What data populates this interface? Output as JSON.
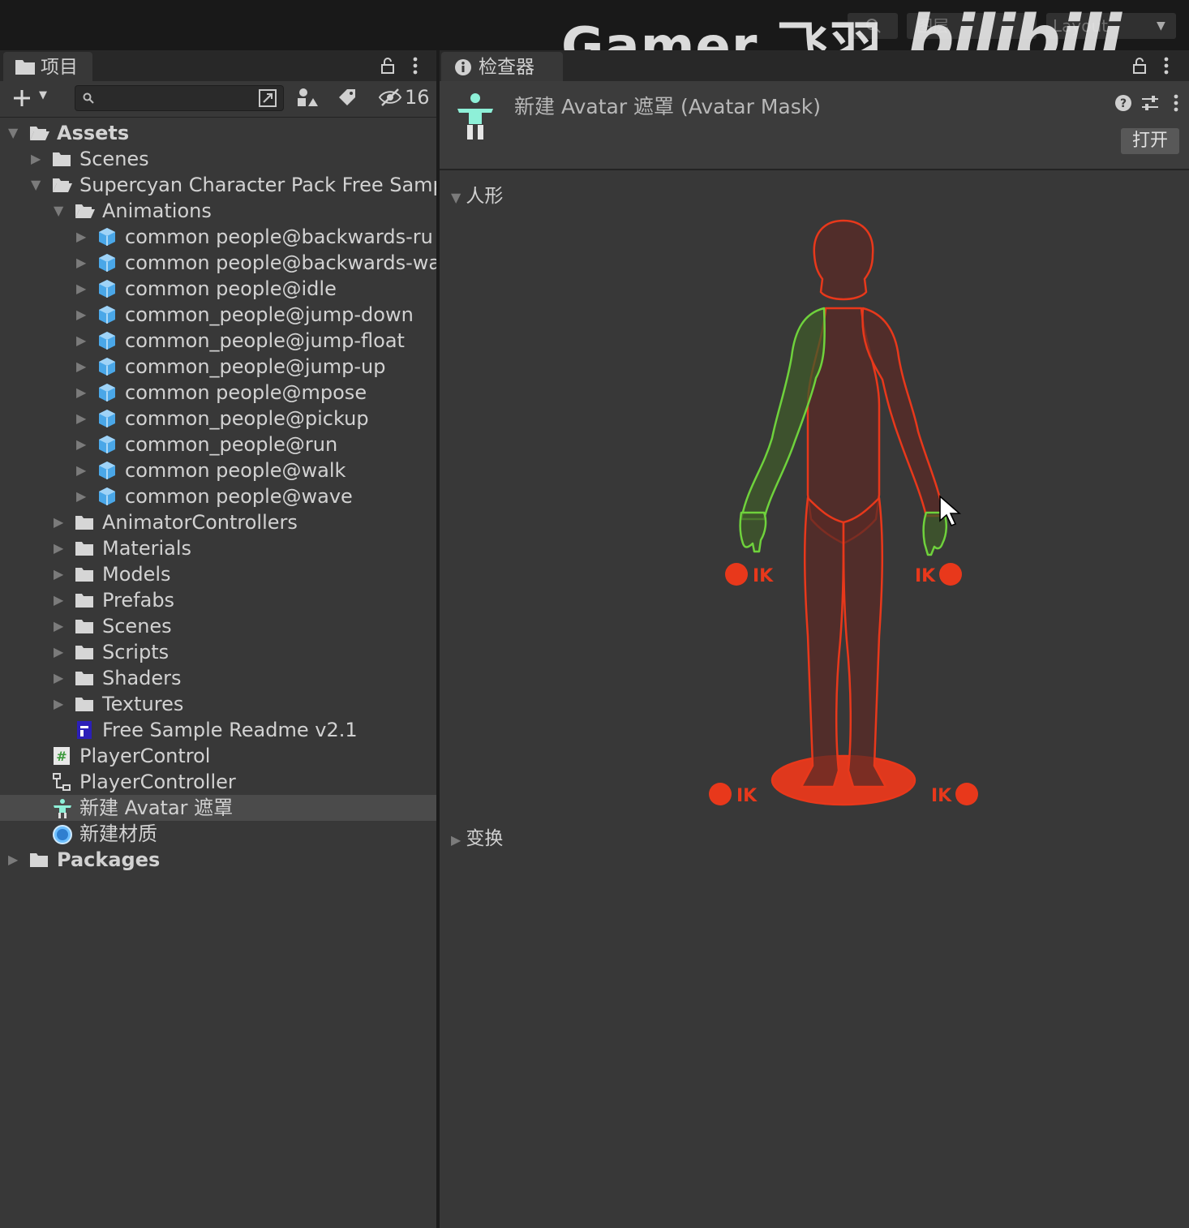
{
  "watermark": {
    "text": "Gamer 飞羽",
    "logo": "bilibili"
  },
  "topbar": {
    "layers_label": "图层",
    "layout_label": "Layout"
  },
  "project": {
    "tab_label": "项目",
    "hidden_count": "16",
    "tree": [
      {
        "label": "Assets",
        "depth": 0,
        "expanded": true,
        "icon": "folder-open-icon",
        "bold": true
      },
      {
        "label": "Scenes",
        "depth": 1,
        "expanded": false,
        "icon": "folder-icon"
      },
      {
        "label": "Supercyan Character Pack Free Sampl",
        "depth": 1,
        "expanded": true,
        "icon": "folder-open-icon"
      },
      {
        "label": "Animations",
        "depth": 2,
        "expanded": true,
        "icon": "folder-open-icon"
      },
      {
        "label": "common people@backwards-ru",
        "depth": 3,
        "expanded": false,
        "icon": "model-icon"
      },
      {
        "label": "common people@backwards-wa",
        "depth": 3,
        "expanded": false,
        "icon": "model-icon"
      },
      {
        "label": "common people@idle",
        "depth": 3,
        "expanded": false,
        "icon": "model-icon"
      },
      {
        "label": "common_people@jump-down",
        "depth": 3,
        "expanded": false,
        "icon": "model-icon"
      },
      {
        "label": "common_people@jump-float",
        "depth": 3,
        "expanded": false,
        "icon": "model-icon"
      },
      {
        "label": "common_people@jump-up",
        "depth": 3,
        "expanded": false,
        "icon": "model-icon"
      },
      {
        "label": "common people@mpose",
        "depth": 3,
        "expanded": false,
        "icon": "model-icon"
      },
      {
        "label": "common_people@pickup",
        "depth": 3,
        "expanded": false,
        "icon": "model-icon"
      },
      {
        "label": "common_people@run",
        "depth": 3,
        "expanded": false,
        "icon": "model-icon"
      },
      {
        "label": "common people@walk",
        "depth": 3,
        "expanded": false,
        "icon": "model-icon"
      },
      {
        "label": "common people@wave",
        "depth": 3,
        "expanded": false,
        "icon": "model-icon"
      },
      {
        "label": "AnimatorControllers",
        "depth": 2,
        "expanded": false,
        "icon": "folder-icon"
      },
      {
        "label": "Materials",
        "depth": 2,
        "expanded": false,
        "icon": "folder-icon"
      },
      {
        "label": "Models",
        "depth": 2,
        "expanded": false,
        "icon": "folder-icon"
      },
      {
        "label": "Prefabs",
        "depth": 2,
        "expanded": false,
        "icon": "folder-icon"
      },
      {
        "label": "Scenes",
        "depth": 2,
        "expanded": false,
        "icon": "folder-icon"
      },
      {
        "label": "Scripts",
        "depth": 2,
        "expanded": false,
        "icon": "folder-icon"
      },
      {
        "label": "Shaders",
        "depth": 2,
        "expanded": false,
        "icon": "folder-icon"
      },
      {
        "label": "Textures",
        "depth": 2,
        "expanded": false,
        "icon": "folder-icon"
      },
      {
        "label": "Free Sample Readme v2.1",
        "depth": 2,
        "leaf": true,
        "icon": "readme-icon"
      },
      {
        "label": "PlayerControl",
        "depth": 1,
        "leaf": true,
        "icon": "csharp-script-icon"
      },
      {
        "label": "PlayerController",
        "depth": 1,
        "leaf": true,
        "icon": "animator-controller-icon"
      },
      {
        "label": "新建 Avatar 遮罩",
        "depth": 1,
        "leaf": true,
        "icon": "avatar-mask-icon",
        "selected": true
      },
      {
        "label": "新建材质",
        "depth": 1,
        "leaf": true,
        "icon": "material-icon"
      },
      {
        "label": "Packages",
        "depth": 0,
        "expanded": false,
        "icon": "folder-icon",
        "bold": true
      }
    ]
  },
  "inspector": {
    "tab_label": "检查器",
    "title": "新建 Avatar 遮罩 (Avatar Mask)",
    "open_button": "打开",
    "humanoid_section": "人形",
    "transform_section": "变换",
    "ik_label": "IK",
    "colors": {
      "active": "#6fd23c",
      "inactive": "#e8381b",
      "body_fill": "#5a2a26"
    },
    "body_parts": [
      {
        "name": "head",
        "active": false
      },
      {
        "name": "body",
        "active": false
      },
      {
        "name": "left-arm",
        "active": true
      },
      {
        "name": "right-arm",
        "active": false
      },
      {
        "name": "left-hand",
        "active": true
      },
      {
        "name": "right-hand",
        "active": true
      },
      {
        "name": "left-leg",
        "active": false
      },
      {
        "name": "right-leg",
        "active": false
      },
      {
        "name": "root",
        "active": false
      }
    ]
  }
}
